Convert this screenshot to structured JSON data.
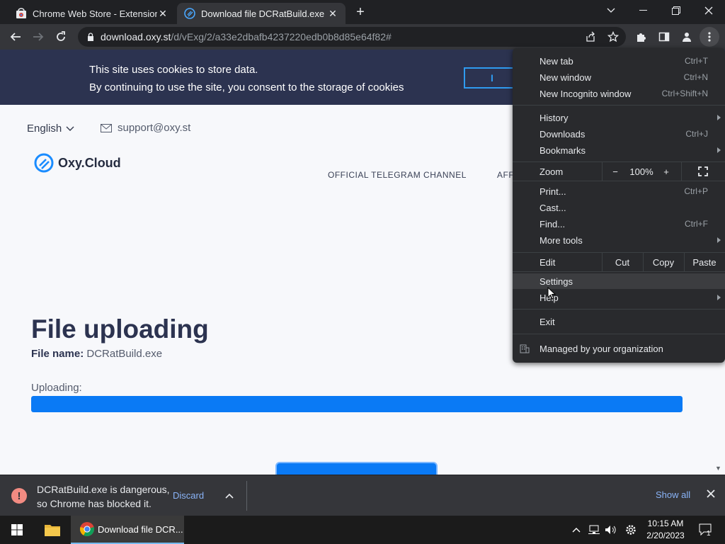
{
  "tabs": [
    {
      "title": "Chrome Web Store - Extensions",
      "close": "✕"
    },
    {
      "title": "Download file DCRatBuild.exe on",
      "close": "✕"
    }
  ],
  "new_tab": "+",
  "window_controls": {
    "minimize": "—",
    "restore": "❐",
    "close": "✕",
    "tab_search": "⌄"
  },
  "address": {
    "host": "download.oxy.st",
    "path": "/d/vExg/2/a33e2dbafb4237220edb0b8d85e64f82#"
  },
  "page": {
    "cookie_line1": "This site uses cookies to store data.",
    "cookie_line2": "By continuing to use the site, you consent to the storage of cookies",
    "cookie_button": "I",
    "language": "English",
    "support_email": "support@oxy.st",
    "logo_text": "Oxy.Cloud",
    "nav_telegram": "OFFICIAL TELEGRAM CHANNEL",
    "nav_second": "AFF",
    "heading": "File uploading",
    "file_name_label": "File name:",
    "file_name_value": "DCRatBuild.exe",
    "uploading_label": "Uploading:",
    "upload_progress": 1.0
  },
  "menu": {
    "new_tab": "New tab",
    "new_tab_sc": "Ctrl+T",
    "new_window": "New window",
    "new_window_sc": "Ctrl+N",
    "incognito": "New Incognito window",
    "incognito_sc": "Ctrl+Shift+N",
    "history": "History",
    "downloads": "Downloads",
    "downloads_sc": "Ctrl+J",
    "bookmarks": "Bookmarks",
    "zoom": "Zoom",
    "zoom_minus": "−",
    "zoom_value": "100%",
    "zoom_plus": "+",
    "print": "Print...",
    "print_sc": "Ctrl+P",
    "cast": "Cast...",
    "find": "Find...",
    "find_sc": "Ctrl+F",
    "more_tools": "More tools",
    "edit": "Edit",
    "cut": "Cut",
    "copy": "Copy",
    "paste": "Paste",
    "settings": "Settings",
    "help": "Help",
    "exit": "Exit",
    "managed": "Managed by your organization"
  },
  "download_bar": {
    "warning_icon": "!",
    "line1": "DCRatBuild.exe is dangerous,",
    "line2": "so Chrome has blocked it.",
    "discard": "Discard",
    "show_all": "Show all"
  },
  "taskbar": {
    "chrome_label": "Download file DCR...",
    "time": "10:15 AM",
    "date": "2/20/2023",
    "notification_count": "1"
  },
  "colors": {
    "accent": "#0a7af5",
    "cookie_bg": "#2c3350",
    "menu_bg": "#292a2d",
    "danger": "#f28b82"
  }
}
